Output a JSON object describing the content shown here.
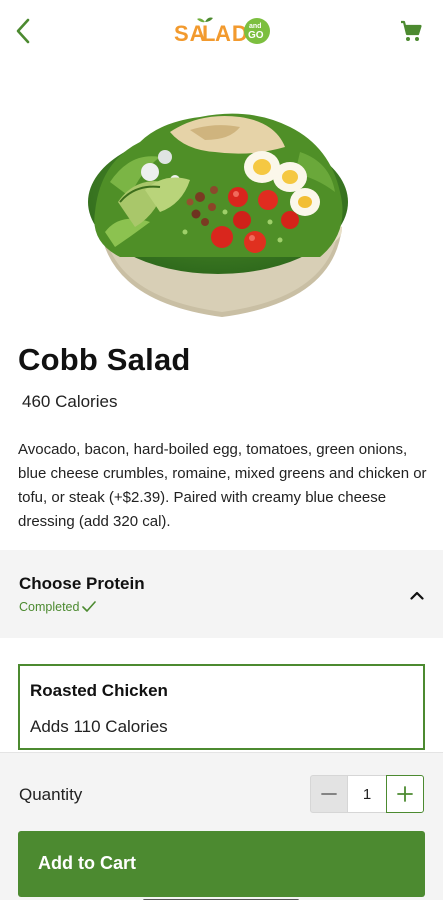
{
  "header": {
    "logo_text": "SALAD AND GO",
    "brand_colors": {
      "green": "#4c8a30",
      "orange": "#f29a2e"
    }
  },
  "item": {
    "name": "Cobb Salad",
    "calories": "460 Calories",
    "description": "Avocado, bacon, hard-boiled egg, tomatoes, green onions, blue cheese crumbles, romaine, mixed greens and chicken or tofu, or steak (+$2.39). Paired with creamy blue cheese dressing (add 320 cal)."
  },
  "protein_section": {
    "title": "Choose Protein",
    "status": "Completed",
    "expanded": true,
    "selected_option": {
      "name": "Roasted Chicken",
      "calories": "Adds 110 Calories"
    }
  },
  "footer": {
    "quantity_label": "Quantity",
    "quantity_value": "1",
    "add_button_label": "Add to Cart"
  },
  "icons": [
    "back-arrow-icon",
    "cart-icon",
    "chevron-up-icon",
    "checkmark-icon",
    "minus-icon",
    "plus-icon"
  ]
}
